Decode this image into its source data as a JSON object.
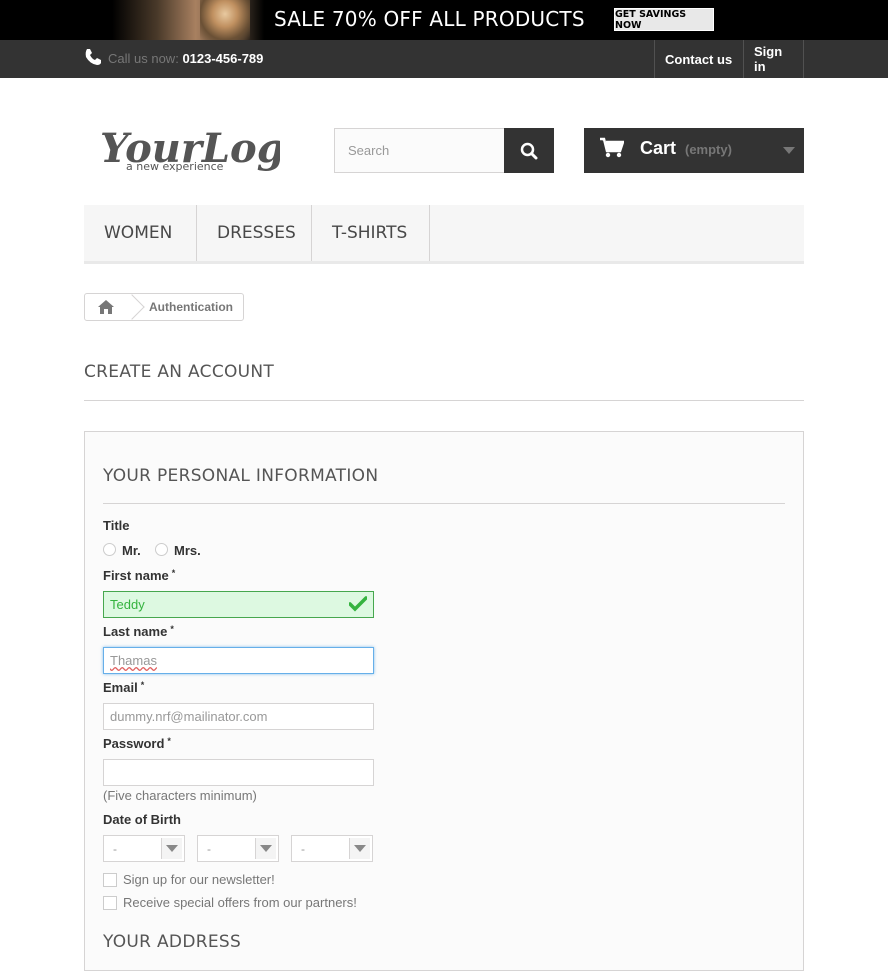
{
  "banner": {
    "text": "SALE 70% OFF ALL PRODUCTS",
    "button_label": "GET SAVINGS NOW"
  },
  "topnav": {
    "call_label": "Call us now:",
    "phone": "0123-456-789",
    "contact_label": "Contact us",
    "signin_label": "Sign in"
  },
  "logo": {
    "main": "YourLogo",
    "tagline": "a new experience"
  },
  "search": {
    "placeholder": "Search"
  },
  "cart": {
    "label": "Cart",
    "status": "(empty)"
  },
  "menu": {
    "items": [
      "WOMEN",
      "DRESSES",
      "T-SHIRTS"
    ]
  },
  "breadcrumb": {
    "current": "Authentication"
  },
  "page": {
    "title": "CREATE AN ACCOUNT"
  },
  "form": {
    "section_title": "YOUR PERSONAL INFORMATION",
    "title_label": "Title",
    "title_options": [
      "Mr.",
      "Mrs."
    ],
    "first_name_label": "First name",
    "first_name_value": "Teddy",
    "last_name_label": "Last name",
    "last_name_value": "Thamas",
    "email_label": "Email",
    "email_value": "dummy.nrf@mailinator.com",
    "password_label": "Password",
    "password_hint": "(Five characters minimum)",
    "dob_label": "Date of Birth",
    "dob_values": [
      "-",
      "-",
      "-"
    ],
    "newsletter_label": "Sign up for our newsletter!",
    "offers_label": "Receive special offers from our partners!",
    "required_mark": "*",
    "address_section_title": "YOUR ADDRESS"
  },
  "colors": {
    "dark": "#333333",
    "valid_green": "#35b33f",
    "focus_blue": "#66afe9"
  }
}
